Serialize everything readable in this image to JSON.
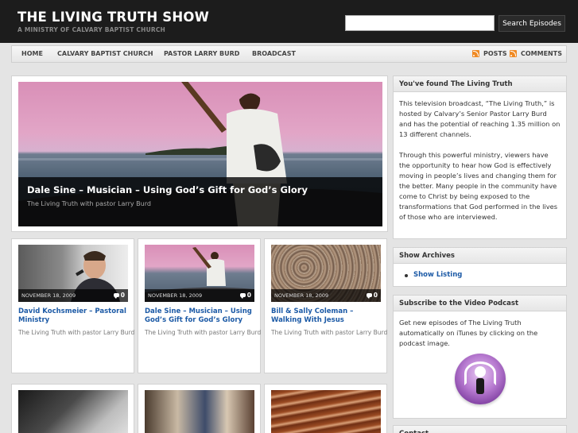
{
  "header": {
    "title": "THE LIVING TRUTH SHOW",
    "tagline": "A MINISTRY OF CALVARY BAPTIST CHURCH",
    "search_value": "",
    "search_button": "Search Episodes"
  },
  "nav": {
    "items": [
      "HOME",
      "CALVARY BAPTIST CHURCH",
      "PASTOR LARRY BURD",
      "BROADCAST"
    ],
    "posts_label": "POSTS",
    "comments_label": "COMMENTS"
  },
  "featured": {
    "title": "Dale Sine – Musician – Using God’s Gift for God’s Glory",
    "subtitle": "The Living Truth with pastor Larry Burd"
  },
  "posts": [
    {
      "date": "NOVEMBER 18, 2009",
      "comments": "0",
      "title": "David Kochsmeier – Pastoral Ministry",
      "excerpt": "The Living Truth with pastor Larry Burd"
    },
    {
      "date": "NOVEMBER 18, 2009",
      "comments": "0",
      "title": "Dale Sine – Musician – Using God’s Gift for God’s Glory",
      "excerpt": "The Living Truth with pastor Larry Burd"
    },
    {
      "date": "NOVEMBER 18, 2009",
      "comments": "0",
      "title": "Bill & Sally Coleman – Walking With Jesus",
      "excerpt": "The Living Truth with pastor Larry Burd"
    }
  ],
  "sidebar": {
    "found": {
      "title": "You've found The Living Truth",
      "p1": "This television broadcast, “The Living Truth,” is hosted by Calvary’s Senior Pastor Larry Burd and has the potential of reaching 1.35 million on 13 different channels.",
      "p2": "Through this powerful ministry, viewers have the opportunity to hear how God is effectively moving in people’s lives and changing them for the better. Many people in the community have come to Christ by being exposed to the transformations that God performed in the lives of those who are interviewed."
    },
    "archives": {
      "title": "Show Archives",
      "link": "Show Listing"
    },
    "podcast": {
      "title": "Subscribe to the Video Podcast",
      "text": "Get new episodes of The Living Truth automatically on iTunes by clicking on the podcast image."
    },
    "contact": {
      "title": "Contact"
    }
  },
  "colors": {
    "header_bg": "#1c1c1c",
    "link": "#1c5aa6",
    "rss": "#f08a24"
  }
}
